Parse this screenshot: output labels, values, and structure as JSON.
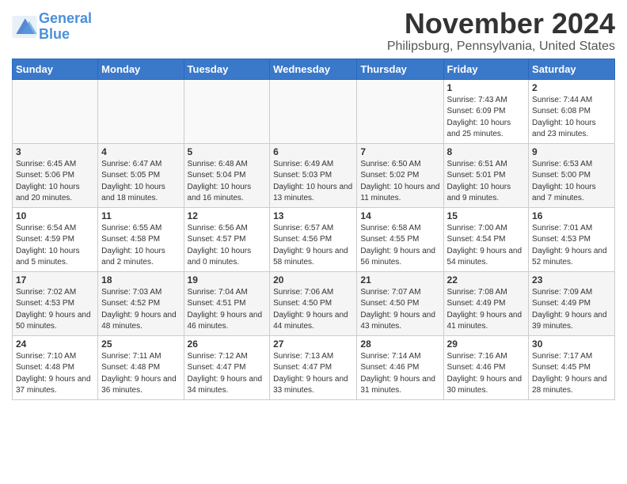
{
  "header": {
    "logo_line1": "General",
    "logo_line2": "Blue",
    "month": "November 2024",
    "location": "Philipsburg, Pennsylvania, United States"
  },
  "weekdays": [
    "Sunday",
    "Monday",
    "Tuesday",
    "Wednesday",
    "Thursday",
    "Friday",
    "Saturday"
  ],
  "weeks": [
    [
      {
        "day": "",
        "info": ""
      },
      {
        "day": "",
        "info": ""
      },
      {
        "day": "",
        "info": ""
      },
      {
        "day": "",
        "info": ""
      },
      {
        "day": "",
        "info": ""
      },
      {
        "day": "1",
        "info": "Sunrise: 7:43 AM\nSunset: 6:09 PM\nDaylight: 10 hours and 25 minutes."
      },
      {
        "day": "2",
        "info": "Sunrise: 7:44 AM\nSunset: 6:08 PM\nDaylight: 10 hours and 23 minutes."
      }
    ],
    [
      {
        "day": "3",
        "info": "Sunrise: 6:45 AM\nSunset: 5:06 PM\nDaylight: 10 hours and 20 minutes."
      },
      {
        "day": "4",
        "info": "Sunrise: 6:47 AM\nSunset: 5:05 PM\nDaylight: 10 hours and 18 minutes."
      },
      {
        "day": "5",
        "info": "Sunrise: 6:48 AM\nSunset: 5:04 PM\nDaylight: 10 hours and 16 minutes."
      },
      {
        "day": "6",
        "info": "Sunrise: 6:49 AM\nSunset: 5:03 PM\nDaylight: 10 hours and 13 minutes."
      },
      {
        "day": "7",
        "info": "Sunrise: 6:50 AM\nSunset: 5:02 PM\nDaylight: 10 hours and 11 minutes."
      },
      {
        "day": "8",
        "info": "Sunrise: 6:51 AM\nSunset: 5:01 PM\nDaylight: 10 hours and 9 minutes."
      },
      {
        "day": "9",
        "info": "Sunrise: 6:53 AM\nSunset: 5:00 PM\nDaylight: 10 hours and 7 minutes."
      }
    ],
    [
      {
        "day": "10",
        "info": "Sunrise: 6:54 AM\nSunset: 4:59 PM\nDaylight: 10 hours and 5 minutes."
      },
      {
        "day": "11",
        "info": "Sunrise: 6:55 AM\nSunset: 4:58 PM\nDaylight: 10 hours and 2 minutes."
      },
      {
        "day": "12",
        "info": "Sunrise: 6:56 AM\nSunset: 4:57 PM\nDaylight: 10 hours and 0 minutes."
      },
      {
        "day": "13",
        "info": "Sunrise: 6:57 AM\nSunset: 4:56 PM\nDaylight: 9 hours and 58 minutes."
      },
      {
        "day": "14",
        "info": "Sunrise: 6:58 AM\nSunset: 4:55 PM\nDaylight: 9 hours and 56 minutes."
      },
      {
        "day": "15",
        "info": "Sunrise: 7:00 AM\nSunset: 4:54 PM\nDaylight: 9 hours and 54 minutes."
      },
      {
        "day": "16",
        "info": "Sunrise: 7:01 AM\nSunset: 4:53 PM\nDaylight: 9 hours and 52 minutes."
      }
    ],
    [
      {
        "day": "17",
        "info": "Sunrise: 7:02 AM\nSunset: 4:53 PM\nDaylight: 9 hours and 50 minutes."
      },
      {
        "day": "18",
        "info": "Sunrise: 7:03 AM\nSunset: 4:52 PM\nDaylight: 9 hours and 48 minutes."
      },
      {
        "day": "19",
        "info": "Sunrise: 7:04 AM\nSunset: 4:51 PM\nDaylight: 9 hours and 46 minutes."
      },
      {
        "day": "20",
        "info": "Sunrise: 7:06 AM\nSunset: 4:50 PM\nDaylight: 9 hours and 44 minutes."
      },
      {
        "day": "21",
        "info": "Sunrise: 7:07 AM\nSunset: 4:50 PM\nDaylight: 9 hours and 43 minutes."
      },
      {
        "day": "22",
        "info": "Sunrise: 7:08 AM\nSunset: 4:49 PM\nDaylight: 9 hours and 41 minutes."
      },
      {
        "day": "23",
        "info": "Sunrise: 7:09 AM\nSunset: 4:49 PM\nDaylight: 9 hours and 39 minutes."
      }
    ],
    [
      {
        "day": "24",
        "info": "Sunrise: 7:10 AM\nSunset: 4:48 PM\nDaylight: 9 hours and 37 minutes."
      },
      {
        "day": "25",
        "info": "Sunrise: 7:11 AM\nSunset: 4:48 PM\nDaylight: 9 hours and 36 minutes."
      },
      {
        "day": "26",
        "info": "Sunrise: 7:12 AM\nSunset: 4:47 PM\nDaylight: 9 hours and 34 minutes."
      },
      {
        "day": "27",
        "info": "Sunrise: 7:13 AM\nSunset: 4:47 PM\nDaylight: 9 hours and 33 minutes."
      },
      {
        "day": "28",
        "info": "Sunrise: 7:14 AM\nSunset: 4:46 PM\nDaylight: 9 hours and 31 minutes."
      },
      {
        "day": "29",
        "info": "Sunrise: 7:16 AM\nSunset: 4:46 PM\nDaylight: 9 hours and 30 minutes."
      },
      {
        "day": "30",
        "info": "Sunrise: 7:17 AM\nSunset: 4:45 PM\nDaylight: 9 hours and 28 minutes."
      }
    ]
  ]
}
